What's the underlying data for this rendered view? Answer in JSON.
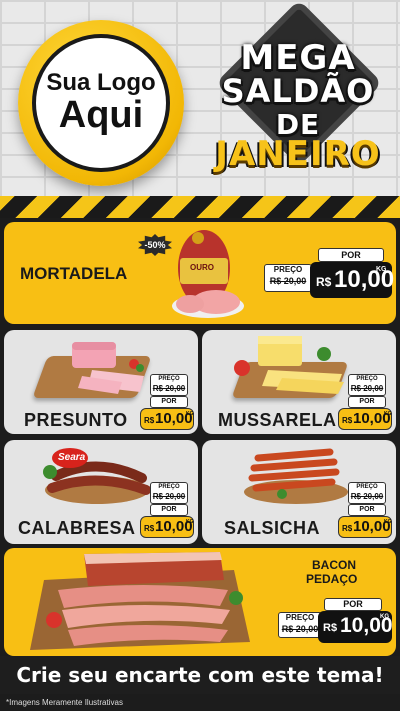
{
  "logo": {
    "line1": "Sua Logo",
    "line2": "Aqui"
  },
  "title": {
    "l1": "MEGA",
    "l2": "SALDÃO",
    "l3": "DE",
    "l4": "JANEIRO"
  },
  "mortadela": {
    "name": "MORTADELA",
    "discount": "-50%",
    "brand": "OURO",
    "preco_label": "PREÇO",
    "old": "R$ 20,00",
    "por": "POR",
    "currency": "R$",
    "new": "10,00",
    "unit": "KG"
  },
  "products": [
    {
      "name": "PRESUNTO",
      "preco_label": "PREÇO",
      "old": "R$ 20,00",
      "por": "POR",
      "currency": "R$",
      "new": "10,00",
      "unit": "KG"
    },
    {
      "name": "MUSSARELA",
      "preco_label": "PREÇO",
      "old": "R$ 20,00",
      "por": "POR",
      "currency": "R$",
      "new": "10,00",
      "unit": "KG"
    },
    {
      "name": "CALABRESA",
      "brand": "Seara",
      "preco_label": "PREÇO",
      "old": "R$ 20,00",
      "por": "POR",
      "currency": "R$",
      "new": "10,00",
      "unit": "KG"
    },
    {
      "name": "SALSICHA",
      "preco_label": "PREÇO",
      "old": "R$ 20,00",
      "por": "POR",
      "currency": "R$",
      "new": "10,00",
      "unit": "KG"
    }
  ],
  "bacon": {
    "name1": "BACON",
    "name2": "PEDAÇO",
    "preco_label": "PREÇO",
    "old": "R$ 20,00",
    "por": "POR",
    "currency": "R$",
    "new": "10,00",
    "unit": "KG"
  },
  "cta": "Crie seu encarte com este tema!",
  "footnote": "*Imagens Meramente Ilustrativas",
  "colors": {
    "yellow": "#f8bf14",
    "dark": "#1a1a1a",
    "card_gray": "#e4e4e4"
  }
}
